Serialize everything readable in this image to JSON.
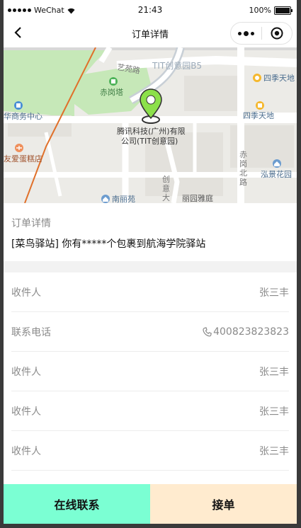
{
  "status_bar": {
    "carrier": "WeChat",
    "time": "21:43",
    "battery": "100%",
    "battery_level": 1.0
  },
  "nav": {
    "title": "订单详情"
  },
  "map": {
    "labels": {
      "yiyuan_road": "艺苑路",
      "tit_park": "TIT创意园B5",
      "sijitiandi_1": "四季天地",
      "sijitiandi_2": "四季天地",
      "chigang_tower": "赤岗塔",
      "business_center": "华商务中心",
      "tencent_line1": "腾讯科技(广州)有限",
      "tencent_line2": "公司(TIT创意园)",
      "cake_shop": "友爱蛋糕店",
      "chigang_north": "赤岗北路",
      "hongjing": "泓景花园",
      "chuangyi": "创意大",
      "nanliyuan": "南丽苑",
      "liyuan": "丽园雅庭"
    }
  },
  "order": {
    "label": "订单详情",
    "content": "[菜鸟驿站] 你有*****个包裹到航海学院驿站"
  },
  "rows": [
    {
      "key": "收件人",
      "value": "张三丰"
    },
    {
      "key": "联系电话",
      "value": "400823823823",
      "icon": "phone-icon"
    },
    {
      "key": "收件人",
      "value": "张三丰"
    },
    {
      "key": "收件人",
      "value": "张三丰"
    },
    {
      "key": "收件人",
      "value": "张三丰"
    }
  ],
  "buttons": {
    "contact": "在线联系",
    "accept": "接单"
  },
  "colors": {
    "contact_bg": "#7bffd3",
    "accept_bg": "#ffebcf",
    "marker": "#8ce04a",
    "route": "#e0702a"
  }
}
